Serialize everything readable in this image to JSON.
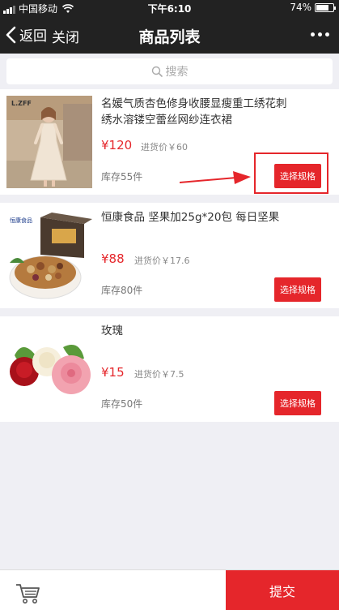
{
  "status": {
    "carrier": "中国移动",
    "time": "下午6:10",
    "battery": "74%",
    "battery_level": 0.74
  },
  "nav": {
    "back_label": "返回",
    "close_label": "关闭",
    "title": "商品列表"
  },
  "search": {
    "placeholder": "搜索"
  },
  "products": [
    {
      "name": "名媛气质杏色修身收腰显瘦重工绣花刺绣水溶镂空蕾丝网纱连衣裙",
      "price": "¥120",
      "cost": "进货价￥60",
      "stock": "库存55件",
      "button": "选择规格",
      "image_brand": "L.ZFF"
    },
    {
      "name": "恒康食品 坚果加25g*20包 每日坚果",
      "price": "¥88",
      "cost": "进货价￥17.6",
      "stock": "库存80件",
      "button": "选择规格",
      "image_brand": "恒康食品"
    },
    {
      "name": "玫瑰",
      "price": "¥15",
      "cost": "进货价￥7.5",
      "stock": "库存50件",
      "button": "选择规格"
    }
  ],
  "bottom": {
    "submit_label": "提交"
  },
  "colors": {
    "accent": "#e5262b",
    "header": "#222222",
    "background": "#efeff4"
  }
}
